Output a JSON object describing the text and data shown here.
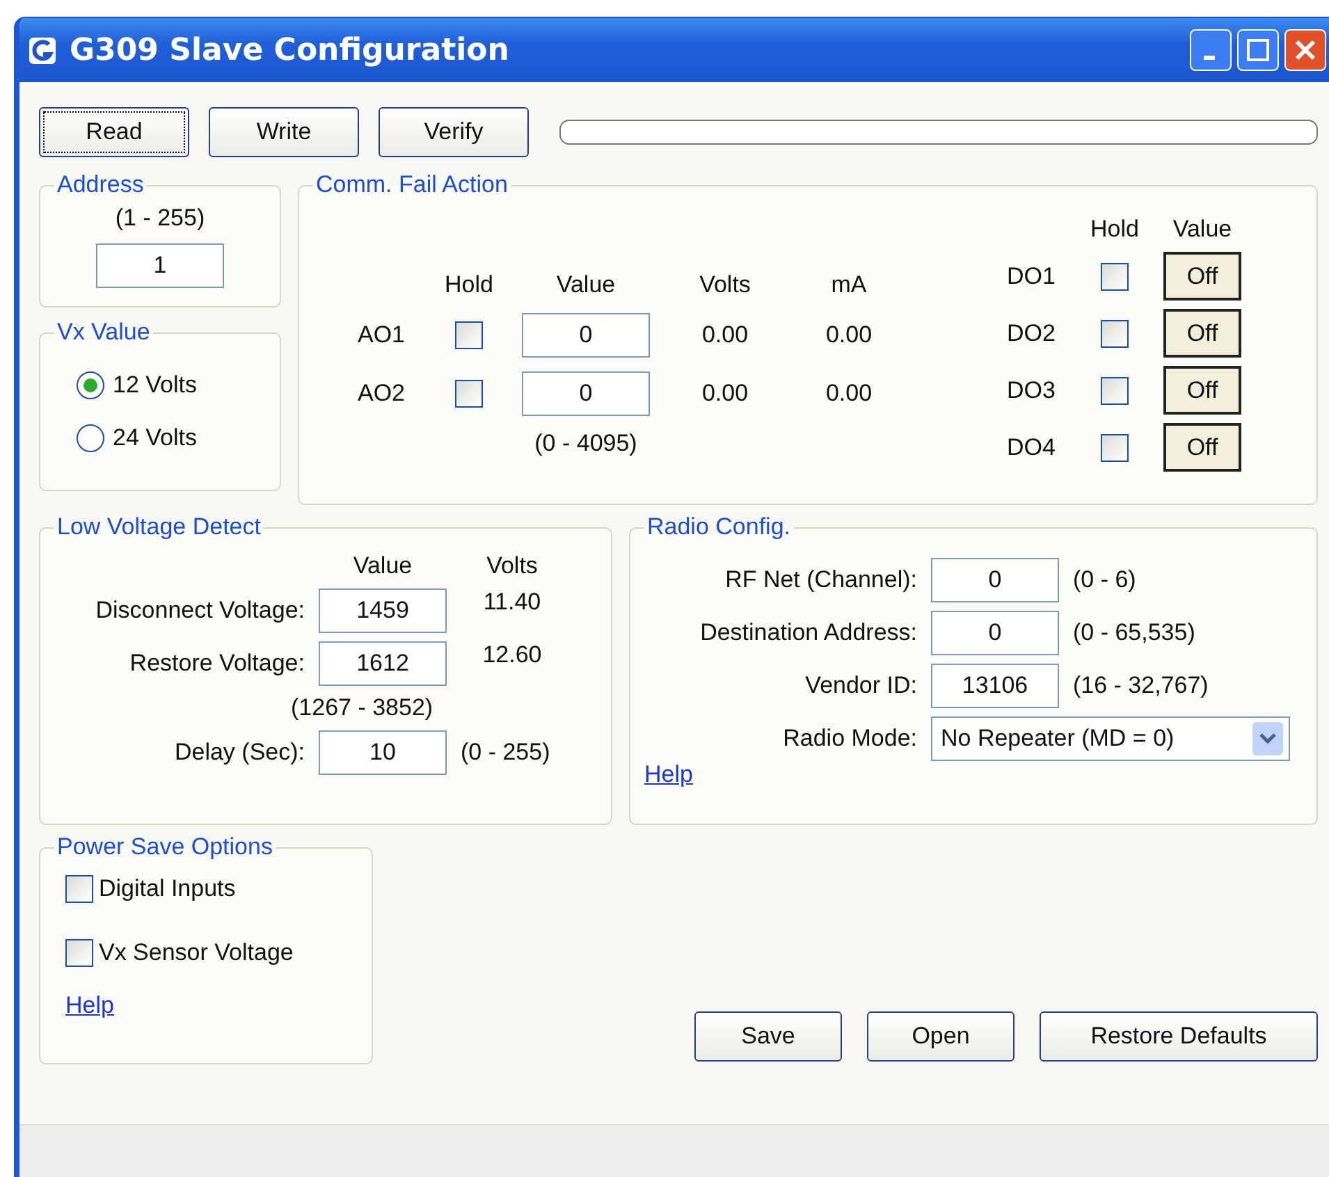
{
  "window": {
    "title": "G309 Slave Configuration"
  },
  "toolbar": {
    "buttons": [
      {
        "label": "Read",
        "focused": true
      },
      {
        "label": "Write",
        "focused": false
      },
      {
        "label": "Verify",
        "focused": false
      }
    ]
  },
  "address": {
    "title": "Address",
    "range": "(1 - 255)",
    "value": "1"
  },
  "vx_value": {
    "title": "Vx Value",
    "options": [
      {
        "label": "12 Volts",
        "selected": true
      },
      {
        "label": "24 Volts",
        "selected": false
      }
    ]
  },
  "comm_fail_action": {
    "title": "Comm. Fail Action",
    "analog": {
      "headers": [
        "Hold",
        "Value",
        "Volts",
        "mA"
      ],
      "rows": [
        {
          "label": "AO1",
          "hold": false,
          "value": "0",
          "volts": "0.00",
          "ma": "0.00"
        },
        {
          "label": "AO2",
          "hold": false,
          "value": "0",
          "volts": "0.00",
          "ma": "0.00"
        }
      ],
      "range": "(0 - 4095)"
    },
    "digital": {
      "headers": [
        "Hold",
        "Value"
      ],
      "rows": [
        {
          "label": "DO1",
          "hold": false,
          "value": "Off"
        },
        {
          "label": "DO2",
          "hold": false,
          "value": "Off"
        },
        {
          "label": "DO3",
          "hold": false,
          "value": "Off"
        },
        {
          "label": "DO4",
          "hold": false,
          "value": "Off"
        }
      ]
    }
  },
  "low_voltage_detect": {
    "title": "Low Voltage Detect",
    "headers": [
      "Value",
      "Volts"
    ],
    "rows": [
      {
        "label": "Disconnect Voltage:",
        "value": "1459",
        "volts": "11.40"
      },
      {
        "label": "Restore Voltage:",
        "value": "1612",
        "volts": "12.60"
      }
    ],
    "range": "(1267 - 3852)",
    "delay": {
      "label": "Delay (Sec):",
      "value": "10",
      "range": "(0 - 255)"
    }
  },
  "radio_config": {
    "title": "Radio Config.",
    "fields": [
      {
        "kind": "text",
        "label": "RF Net (Channel):",
        "value": "0",
        "range": "(0 - 6)"
      },
      {
        "kind": "text",
        "label": "Destination Address:",
        "value": "0",
        "range": "(0 - 65,535)"
      },
      {
        "kind": "text",
        "label": "Vendor ID:",
        "value": "13106",
        "range": "(16 - 32,767)"
      },
      {
        "kind": "select",
        "label": "Radio Mode:",
        "value": "No Repeater (MD = 0)"
      }
    ],
    "help": "Help"
  },
  "power_save_options": {
    "title": "Power Save Options",
    "options": [
      {
        "label": "Digital Inputs",
        "checked": false
      },
      {
        "label": "Vx Sensor Voltage",
        "checked": false
      }
    ],
    "help": "Help"
  },
  "footer_buttons": [
    "Save",
    "Open",
    "Restore Defaults"
  ]
}
